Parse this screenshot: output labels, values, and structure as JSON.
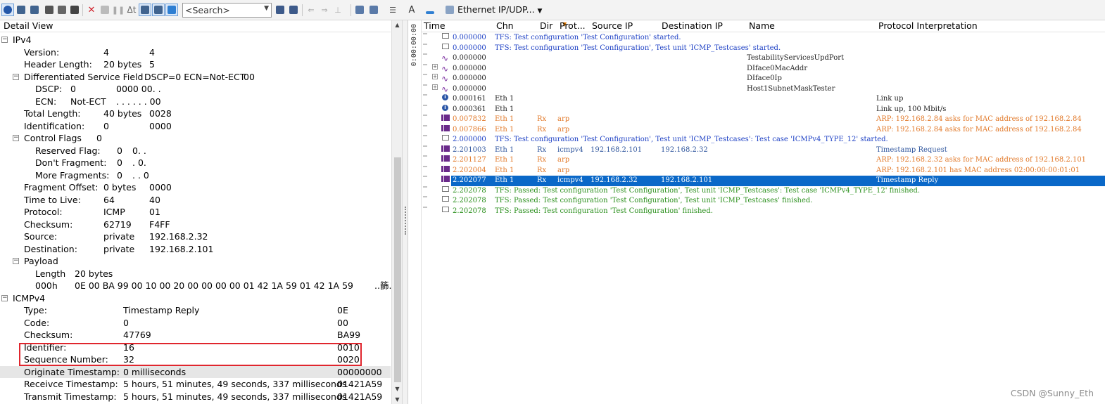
{
  "toolbar": {
    "search_placeholder": "<Search>",
    "filter_label": "Ethernet IP/UDP...",
    "font_button": "A"
  },
  "detail": {
    "header": "Detail View",
    "rows": [
      {
        "label": "IPv4",
        "v1": "",
        "v2": "",
        "level": 0,
        "expander": "−"
      },
      {
        "label": "Version:",
        "v1": "4",
        "v2": "4",
        "level": 1
      },
      {
        "label": "Header Length:",
        "v1": "20 bytes",
        "v2": "5",
        "level": 1
      },
      {
        "label": "Differentiated Service Field",
        "v1": "DSCP=0 ECN=Not-ECT",
        "v2": "00",
        "level": 1,
        "expander": "−"
      },
      {
        "label": "DSCP:",
        "v1": "0",
        "v2": "0000 00. .",
        "level": 2
      },
      {
        "label": "ECN:",
        "v1": "Not-ECT",
        "v2": ". . . . . . 00",
        "level": 2
      },
      {
        "label": "Total Length:",
        "v1": "40 bytes",
        "v2": "0028",
        "level": 1
      },
      {
        "label": "Identification:",
        "v1": "0",
        "v2": "0000",
        "level": 1
      },
      {
        "label": "Control Flags",
        "v1": "0",
        "v2": "",
        "level": 1,
        "expander": "−"
      },
      {
        "label": "Reserved Flag:",
        "v1": "0",
        "v2": "0. .",
        "level": 2
      },
      {
        "label": "Don't Fragment:",
        "v1": "0",
        "v2": ". 0.",
        "level": 2
      },
      {
        "label": "More Fragments:",
        "v1": "0",
        "v2": ". . 0",
        "level": 2
      },
      {
        "label": "Fragment Offset:",
        "v1": "0 bytes",
        "v2": "0000",
        "level": 1
      },
      {
        "label": "Time to Live:",
        "v1": "64",
        "v2": "40",
        "level": 1
      },
      {
        "label": "Protocol:",
        "v1": "ICMP",
        "v2": "01",
        "level": 1
      },
      {
        "label": "Checksum:",
        "v1": "62719",
        "v2": "F4FF",
        "level": 1
      },
      {
        "label": "Source:",
        "v1": "private",
        "v2": "192.168.2.32",
        "level": 1
      },
      {
        "label": "Destination:",
        "v1": "private",
        "v2": "192.168.2.101",
        "level": 1
      },
      {
        "label": "Payload",
        "v1": "",
        "v2": "",
        "level": 1,
        "expander": "−"
      },
      {
        "label": "Length",
        "v1": "20 bytes",
        "v2": "",
        "level": 2
      },
      {
        "label": "000h",
        "v1": "0E  00  BA  99  00  10  00  20  00  00  00  00  01  42  1A  59  01  42  1A  59",
        "v2": "..籂.",
        "level": 2
      },
      {
        "label": "ICMPv4",
        "v1": "",
        "v2": "",
        "level": 0,
        "expander": "−"
      },
      {
        "label": "Type:",
        "v1": "Timestamp Reply",
        "v2": "0E",
        "level": 1
      },
      {
        "label": "Code:",
        "v1": "0",
        "v2": "00",
        "level": 1
      },
      {
        "label": "Checksum:",
        "v1": "47769",
        "v2": "BA99",
        "level": 1
      },
      {
        "label": "Identifier:",
        "v1": "16",
        "v2": "0010",
        "level": 1
      },
      {
        "label": "Sequence Number:",
        "v1": "32",
        "v2": "0020",
        "level": 1
      },
      {
        "label": "Originate Timestamp:",
        "v1": "0 milliseconds",
        "v2": "00000000",
        "level": 1,
        "selected": true
      },
      {
        "label": "Receivce Timestamp:",
        "v1": "5 hours, 51 minutes, 49 seconds, 337 milliseconds",
        "v2": "01421A59",
        "level": 1
      },
      {
        "label": "Transmit Timestamp:",
        "v1": "5 hours, 51 minutes, 49 seconds, 337 milliseconds",
        "v2": "01421A59",
        "level": 1
      }
    ]
  },
  "trace": {
    "clock": "0:00:00:00",
    "columns": [
      "Time",
      "Chn",
      "Dir",
      "Prot...",
      "Source IP",
      "Destination IP",
      "Name",
      "Protocol Interpretation"
    ],
    "rows": [
      {
        "icon": "env",
        "time": "0.000000",
        "chn": "TFS: Test configuration 'Test Configuration' started.",
        "dir": "",
        "prot": "",
        "src": "",
        "dst": "",
        "name": "",
        "interp": "",
        "color": "blue"
      },
      {
        "icon": "env",
        "time": "0.000000",
        "chn": "TFS: Test configuration 'Test Configuration', Test unit 'ICMP_Testcases' started.",
        "dir": "",
        "prot": "",
        "src": "",
        "dst": "",
        "name": "",
        "interp": "",
        "color": "blue"
      },
      {
        "icon": "wave",
        "time": "0.000000",
        "chn": "",
        "dir": "",
        "prot": "",
        "src": "",
        "dst": "",
        "name": "TestabilityServicesUpdPort",
        "interp": "",
        "color": "black"
      },
      {
        "icon": "wave",
        "plus": true,
        "time": "0.000000",
        "chn": "",
        "dir": "",
        "prot": "",
        "src": "",
        "dst": "",
        "name": "DIface0MacAddr",
        "interp": "",
        "color": "black"
      },
      {
        "icon": "wave",
        "plus": true,
        "time": "0.000000",
        "chn": "",
        "dir": "",
        "prot": "",
        "src": "",
        "dst": "",
        "name": "DIface0Ip",
        "interp": "",
        "color": "black"
      },
      {
        "icon": "wave",
        "plus": true,
        "time": "0.000000",
        "chn": "",
        "dir": "",
        "prot": "",
        "src": "",
        "dst": "",
        "name": "Host1SubnetMaskTester",
        "interp": "",
        "color": "black"
      },
      {
        "icon": "info",
        "time": "0.000161",
        "chn": "Eth 1",
        "dir": "",
        "prot": "",
        "src": "",
        "dst": "",
        "name": "",
        "interp": "Link up",
        "color": "black"
      },
      {
        "icon": "info",
        "time": "0.000361",
        "chn": "Eth 1",
        "dir": "",
        "prot": "",
        "src": "",
        "dst": "",
        "name": "",
        "interp": "Link up, 100 Mbit/s",
        "color": "black"
      },
      {
        "icon": "frame",
        "time": "0.007832",
        "chn": "Eth 1",
        "dir": "Rx",
        "prot": "arp",
        "src": "",
        "dst": "",
        "name": "",
        "interp": "ARP: 192.168.2.84 asks for MAC address of 192.168.2.84",
        "color": "orange"
      },
      {
        "icon": "frame",
        "time": "0.007866",
        "chn": "Eth 1",
        "dir": "Rx",
        "prot": "arp",
        "src": "",
        "dst": "",
        "name": "",
        "interp": "ARP: 192.168.2.84 asks for MAC address of 192.168.2.84",
        "color": "orange"
      },
      {
        "icon": "env",
        "time": "2.000000",
        "chn": "TFS: Test configuration 'Test Configuration', Test unit 'ICMP_Testcases': Test case 'ICMPv4_TYPE_12' started.",
        "dir": "",
        "prot": "",
        "src": "",
        "dst": "",
        "name": "",
        "interp": "",
        "color": "blue"
      },
      {
        "icon": "frame",
        "time": "2.201003",
        "chn": "Eth 1",
        "dir": "Rx",
        "prot": "icmpv4",
        "src": "192.168.2.101",
        "dst": "192.168.2.32",
        "name": "",
        "interp": "Timestamp Request",
        "color": "dblue"
      },
      {
        "icon": "frame",
        "time": "2.201127",
        "chn": "Eth 1",
        "dir": "Rx",
        "prot": "arp",
        "src": "",
        "dst": "",
        "name": "",
        "interp": "ARP: 192.168.2.32 asks for MAC address of 192.168.2.101",
        "color": "orange"
      },
      {
        "icon": "frame",
        "time": "2.202004",
        "chn": "Eth 1",
        "dir": "Rx",
        "prot": "arp",
        "src": "",
        "dst": "",
        "name": "",
        "interp": "ARP: 192.168.2.101 has MAC address 02:00:00:00:01:01",
        "color": "orange"
      },
      {
        "icon": "frame",
        "time": "2.202077",
        "chn": "Eth 1",
        "dir": "Rx",
        "prot": "icmpv4",
        "src": "192.168.2.32",
        "dst": "192.168.2.101",
        "name": "",
        "interp": "Timestamp Reply",
        "color": "dblue",
        "selected": true
      },
      {
        "icon": "env",
        "time": "2.202078",
        "chn": "TFS: Passed: Test configuration 'Test Configuration', Test unit 'ICMP_Testcases': Test case 'ICMPv4_TYPE_12' finished.",
        "dir": "",
        "prot": "",
        "src": "",
        "dst": "",
        "name": "",
        "interp": "",
        "color": "green"
      },
      {
        "icon": "env",
        "time": "2.202078",
        "chn": "TFS: Passed: Test configuration 'Test Configuration', Test unit 'ICMP_Testcases' finished.",
        "dir": "",
        "prot": "",
        "src": "",
        "dst": "",
        "name": "",
        "interp": "",
        "color": "green"
      },
      {
        "icon": "env",
        "time": "2.202078",
        "chn": "TFS: Passed: Test configuration 'Test Configuration' finished.",
        "dir": "",
        "prot": "",
        "src": "",
        "dst": "",
        "name": "",
        "interp": "",
        "color": "green"
      }
    ]
  },
  "watermark": "CSDN @Sunny_Eth",
  "colors": {
    "selection": "#0a68c8",
    "highlight_box": "#e0262e"
  }
}
